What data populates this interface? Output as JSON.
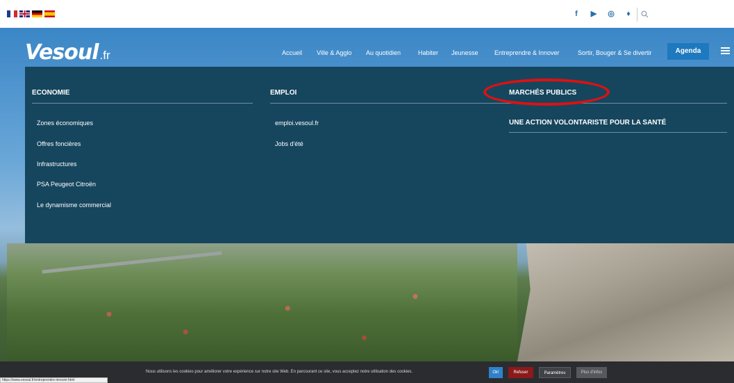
{
  "topbar": {
    "languages": [
      "Français",
      "English",
      "Deutsch",
      "Español"
    ],
    "social": [
      {
        "icon": "facebook-icon",
        "glyph": "f"
      },
      {
        "icon": "youtube-icon",
        "glyph": "▶"
      },
      {
        "icon": "instagram-icon",
        "glyph": "◎"
      },
      {
        "icon": "twitter-icon",
        "glyph": "♦"
      }
    ],
    "search_placeholder": ""
  },
  "header": {
    "logo_main": "Vesoul",
    "logo_tld": ".fr",
    "nav": [
      {
        "label": "Accueil"
      },
      {
        "label": "Ville & Agglo"
      },
      {
        "label": "Au quotidien"
      },
      {
        "label": "Habiter"
      },
      {
        "label": "Jeunesse"
      },
      {
        "label": "Entreprendre & Innover"
      },
      {
        "label": "Sortir, Bouger & Se divertir"
      }
    ],
    "agenda_label": "Agenda"
  },
  "mega_menu": {
    "columns": [
      {
        "heading": "ECONOMIE",
        "items": [
          "Zones économiques",
          "Offres foncières",
          "Infrastructures",
          "PSA Peugeot Citroën",
          "Le dynamisme commercial"
        ]
      },
      {
        "heading": "EMPLOI",
        "items": [
          "emploi.vesoul.fr",
          "Jobs d'été"
        ]
      },
      {
        "heading": "MARCHÉS PUBLICS",
        "items": []
      },
      {
        "heading": "UNE ACTION VOLONTARISTE POUR LA SANTÉ",
        "items": []
      }
    ]
  },
  "cookie": {
    "text": "Nous utilisons les cookies pour améliorer votre expérience sur notre site Web. En parcourant ce site, vous acceptez notre utilisation des cookies.",
    "ok": "Ok!",
    "refuse": "Refuser",
    "params": "Paramètres",
    "more": "Plus d'infos"
  },
  "status_url": "https://www.vesoul.fr/entreprendre-innover.html",
  "colors": {
    "menu_bg": "#16465e",
    "agenda_bg": "#1e79be",
    "highlight": "#e01010",
    "cookie_bg": "#2b2c2f"
  }
}
